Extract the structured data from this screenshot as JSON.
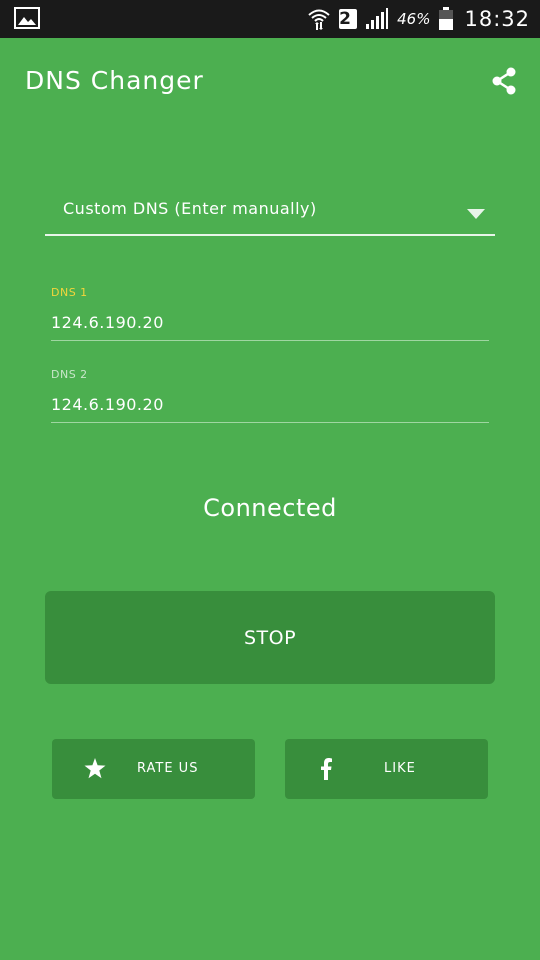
{
  "status_bar": {
    "sim_slot": "2",
    "battery": "46%",
    "time": "18:32"
  },
  "app": {
    "title": "DNS Changer"
  },
  "dns_selector": {
    "selected": "Custom DNS (Enter manually)"
  },
  "fields": {
    "dns1_label": "DNS 1",
    "dns1_value": "124.6.190.20",
    "dns2_label": "DNS 2",
    "dns2_value": "124.6.190.20"
  },
  "status": {
    "text": "Connected"
  },
  "buttons": {
    "stop_label": "STOP",
    "rate_label": "RATE US",
    "like_label": "LIKE"
  },
  "colors": {
    "background": "#4caf50",
    "button": "#388e3c",
    "accent": "#f2d53c",
    "status_bar": "#1a1a1a"
  },
  "icons": {
    "share": "share-icon",
    "rate": "star-icon",
    "like": "facebook-icon",
    "dropdown": "caret-down-icon"
  }
}
